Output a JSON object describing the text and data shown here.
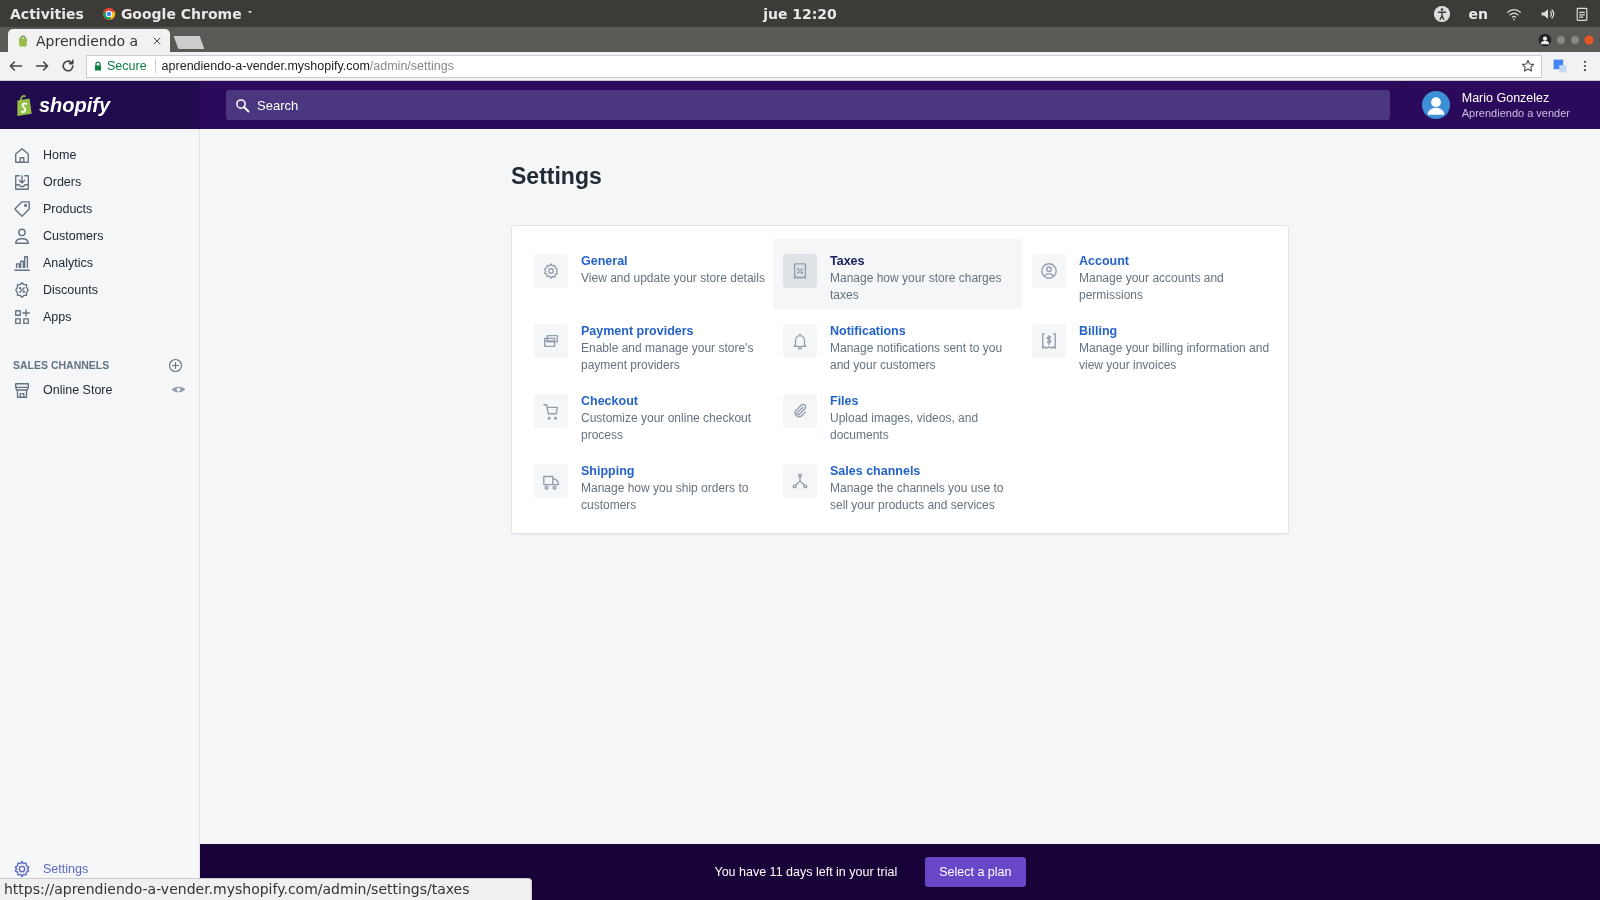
{
  "system_bar": {
    "activities": "Activities",
    "app": "Google Chrome",
    "clock": "jue 12:20",
    "language": "en"
  },
  "browser": {
    "tab_title": "Aprendiendo a",
    "secure_label": "Secure",
    "url_host": "aprendiendo-a-vender.myshopify.com",
    "url_path": "/admin/settings",
    "status_url": "https://aprendiendo-a-vender.myshopify.com/admin/settings/taxes"
  },
  "header": {
    "logo": "shopify",
    "search": {
      "placeholder": "Search"
    },
    "user": {
      "name": "Mario Gonzelez",
      "store": "Aprendiendo a vender"
    }
  },
  "sidebar": {
    "items": [
      {
        "label": "Home",
        "selected": false
      },
      {
        "label": "Orders",
        "selected": false
      },
      {
        "label": "Products",
        "selected": false
      },
      {
        "label": "Customers",
        "selected": false
      },
      {
        "label": "Analytics",
        "selected": false
      },
      {
        "label": "Discounts",
        "selected": false
      },
      {
        "label": "Apps",
        "selected": false
      }
    ],
    "section_title": "SALES CHANNELS",
    "channels": [
      {
        "label": "Online Store",
        "selected": false
      }
    ],
    "footer_items": [
      {
        "label": "Settings",
        "selected": true
      }
    ]
  },
  "page": {
    "title": "Settings",
    "columns": [
      [
        {
          "title": "General",
          "description": "View and update your store details",
          "highlighted": false
        },
        {
          "title": "Payment providers",
          "description": "Enable and manage your store's payment providers",
          "highlighted": false
        },
        {
          "title": "Checkout",
          "description": "Customize your online checkout process",
          "highlighted": false
        },
        {
          "title": "Shipping",
          "description": "Manage how you ship orders to customers",
          "highlighted": false
        }
      ],
      [
        {
          "title": "Taxes",
          "description": "Manage how your store charges taxes",
          "highlighted": true
        },
        {
          "title": "Notifications",
          "description": "Manage notifications sent to you and your customers",
          "highlighted": false
        },
        {
          "title": "Files",
          "description": "Upload images, videos, and documents",
          "highlighted": false
        },
        {
          "title": "Sales channels",
          "description": "Manage the channels you use to sell your products and services",
          "highlighted": false
        }
      ],
      [
        {
          "title": "Account",
          "description": "Manage your accounts and permissions",
          "highlighted": false
        },
        {
          "title": "Billing",
          "description": "Manage your billing information and view your invoices",
          "highlighted": false
        }
      ]
    ]
  },
  "trial_bar": {
    "message": "You have 11 days left in your trial",
    "button": "Select a plan"
  }
}
